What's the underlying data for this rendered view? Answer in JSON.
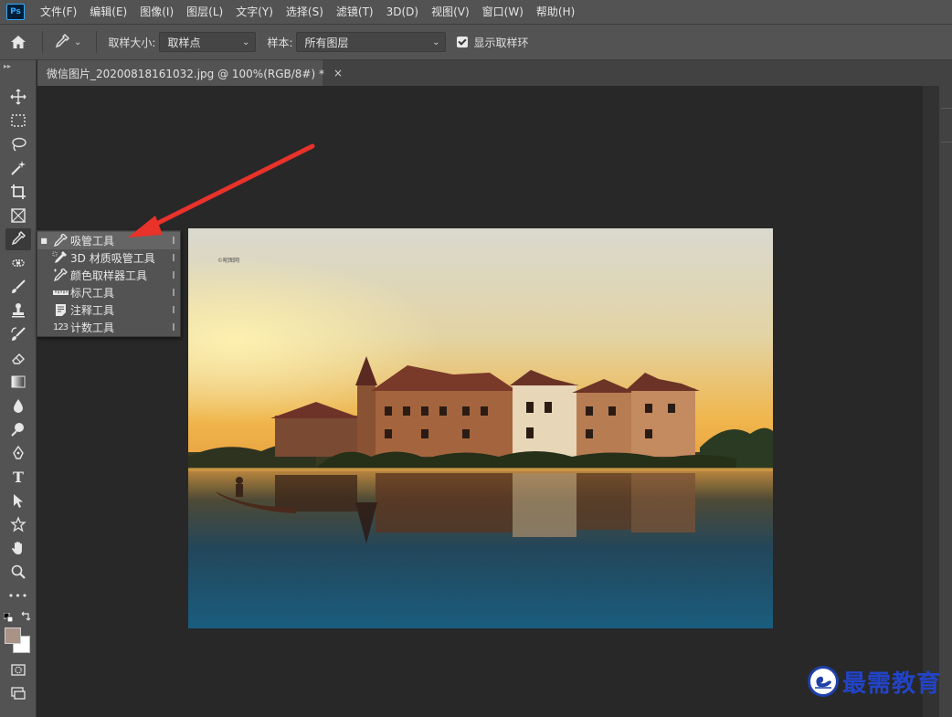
{
  "app": {
    "logo": "Ps"
  },
  "menu": [
    "文件(F)",
    "编辑(E)",
    "图像(I)",
    "图层(L)",
    "文字(Y)",
    "选择(S)",
    "滤镜(T)",
    "3D(D)",
    "视图(V)",
    "窗口(W)",
    "帮助(H)"
  ],
  "options": {
    "sample_size_label": "取样大小:",
    "sample_size_value": "取样点",
    "sample_label": "样本:",
    "sample_value": "所有图层",
    "show_ring_label": "显示取样环",
    "show_ring_checked": true
  },
  "document": {
    "tab_title": "微信图片_20200818161032.jpg @ 100%(RGB/8#) *",
    "close_glyph": "×",
    "image_watermark": "©昵图网"
  },
  "flyout": {
    "items": [
      {
        "label": "吸管工具",
        "key": "I",
        "icon": "eyedropper-icon",
        "selected": true
      },
      {
        "label": "3D 材质吸管工具",
        "key": "I",
        "icon": "3d-material-eyedropper-icon",
        "selected": false
      },
      {
        "label": "颜色取样器工具",
        "key": "I",
        "icon": "color-sampler-icon",
        "selected": false
      },
      {
        "label": "标尺工具",
        "key": "I",
        "icon": "ruler-icon",
        "selected": false
      },
      {
        "label": "注释工具",
        "key": "I",
        "icon": "note-icon",
        "selected": false
      },
      {
        "label": "计数工具",
        "key": "I",
        "icon": "count-icon",
        "selected": false
      }
    ],
    "count_icon_text": "123"
  },
  "toolbar": {
    "type_tool_glyph": "T",
    "more_glyph": "•••",
    "foreground_color": "#a99386",
    "background_color": "#ffffff"
  },
  "watermark": {
    "name": "最需教育"
  },
  "colors": {
    "accent_arrow": "#e8322a",
    "ps_blue": "#31a8ff"
  }
}
